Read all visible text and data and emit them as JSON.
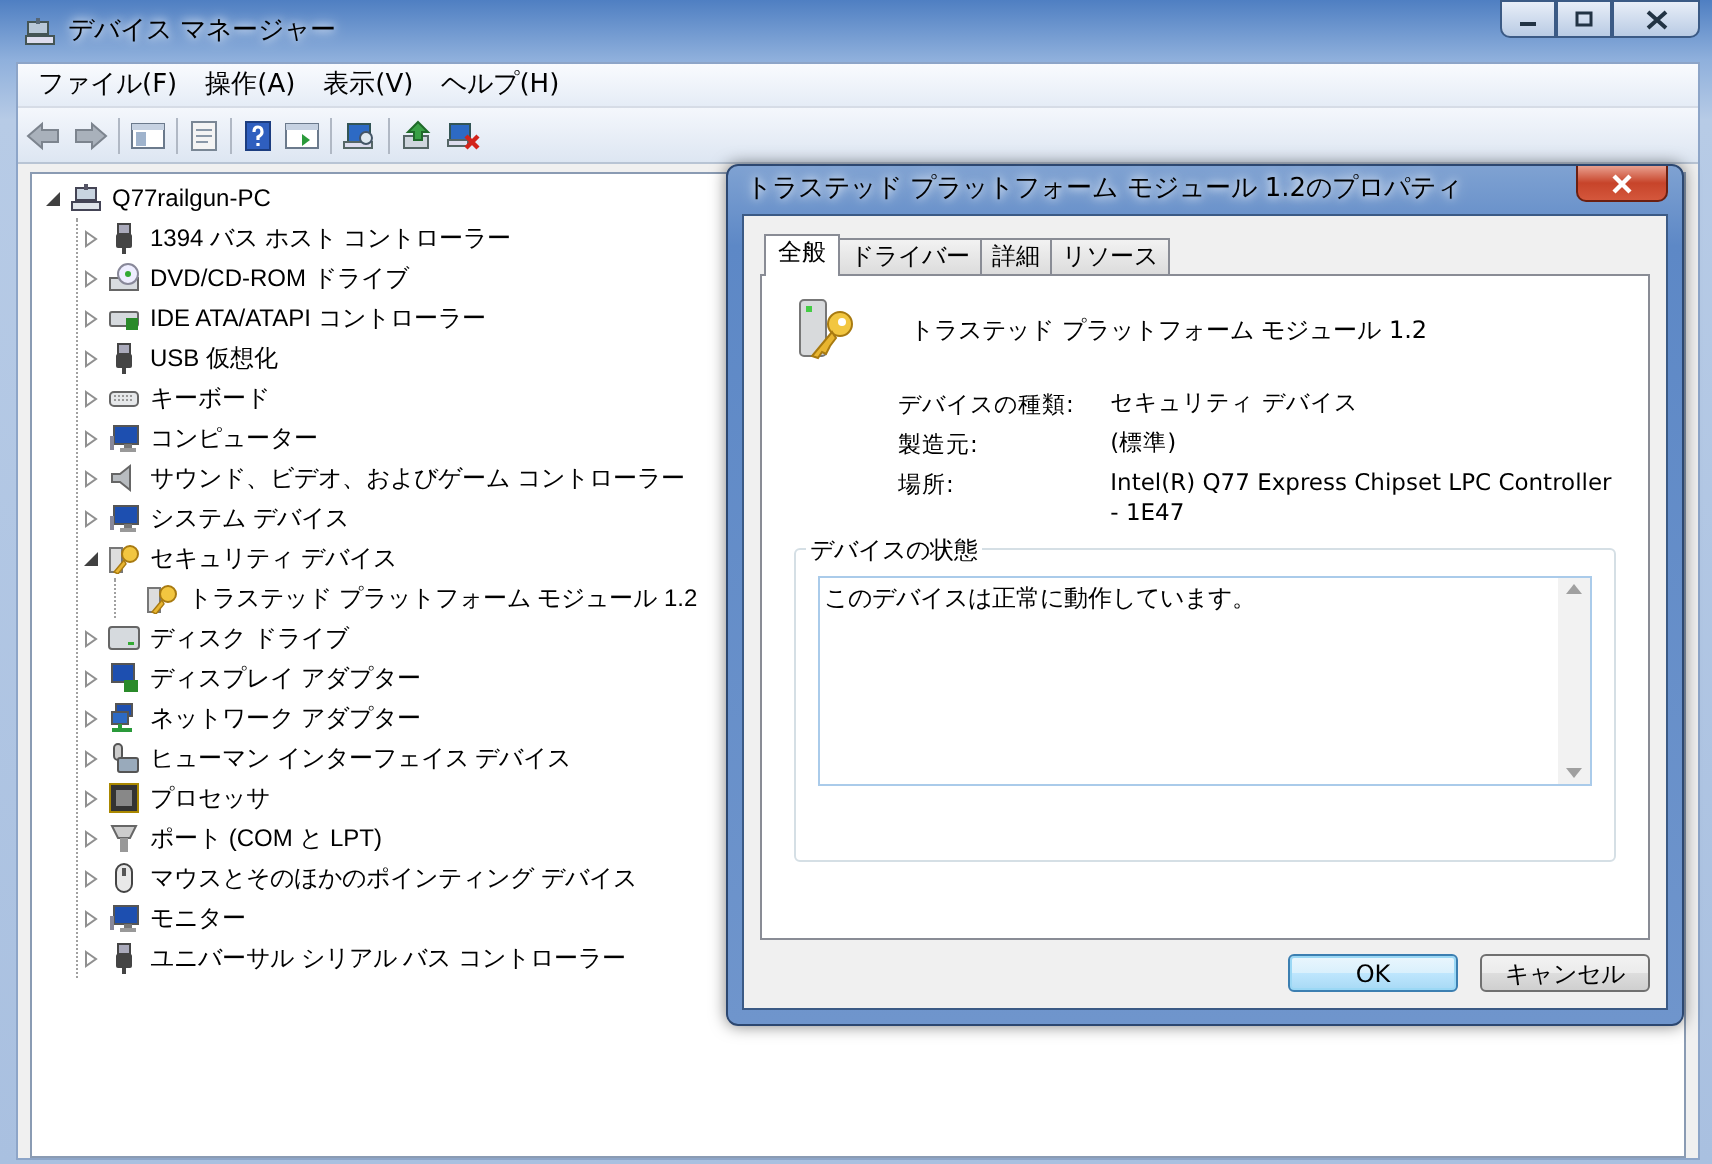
{
  "window": {
    "title": "デバイス マネージャー"
  },
  "menu": [
    "ファイル(F)",
    "操作(A)",
    "表示(V)",
    "ヘルプ(H)"
  ],
  "tree": {
    "label": "Q77railgun-PC",
    "kind": "computer",
    "expanded": true,
    "children": [
      {
        "label": "1394 バス ホスト コントローラー",
        "kind": "plug",
        "expanded": false
      },
      {
        "label": "DVD/CD-ROM ドライブ",
        "kind": "disc",
        "expanded": false
      },
      {
        "label": "IDE ATA/ATAPI コントローラー",
        "kind": "card",
        "expanded": false
      },
      {
        "label": "USB 仮想化",
        "kind": "plug",
        "expanded": false
      },
      {
        "label": "キーボード",
        "kind": "keyboard",
        "expanded": false
      },
      {
        "label": "コンピューター",
        "kind": "monitor",
        "expanded": false
      },
      {
        "label": "サウンド、ビデオ、およびゲーム コントローラー",
        "kind": "speaker",
        "expanded": false
      },
      {
        "label": "システム デバイス",
        "kind": "monitor",
        "expanded": false
      },
      {
        "label": "セキュリティ デバイス",
        "kind": "key",
        "expanded": true,
        "children": [
          {
            "label": "トラステッド プラットフォーム モジュール 1.2",
            "kind": "key"
          }
        ]
      },
      {
        "label": "ディスク ドライブ",
        "kind": "drive",
        "expanded": false
      },
      {
        "label": "ディスプレイ アダプター",
        "kind": "display",
        "expanded": false
      },
      {
        "label": "ネットワーク アダプター",
        "kind": "network",
        "expanded": false
      },
      {
        "label": "ヒューマン インターフェイス デバイス",
        "kind": "hid",
        "expanded": false
      },
      {
        "label": "プロセッサ",
        "kind": "chip",
        "expanded": false
      },
      {
        "label": "ポート (COM と LPT)",
        "kind": "port",
        "expanded": false
      },
      {
        "label": "マウスとそのほかのポインティング デバイス",
        "kind": "mouse",
        "expanded": false
      },
      {
        "label": "モニター",
        "kind": "monitor",
        "expanded": false
      },
      {
        "label": "ユニバーサル シリアル バス コントローラー",
        "kind": "plug",
        "expanded": false
      }
    ]
  },
  "dialog": {
    "title": "トラステッド プラットフォーム モジュール 1.2のプロパティ",
    "tabs": [
      {
        "label": "全般",
        "selected": true
      },
      {
        "label": "ドライバー",
        "selected": false
      },
      {
        "label": "詳細",
        "selected": false
      },
      {
        "label": "リソース",
        "selected": false
      }
    ],
    "device_name": "トラステッド プラットフォーム モジュール 1.2",
    "properties": [
      {
        "label": "デバイスの種類:",
        "value": "セキュリティ デバイス"
      },
      {
        "label": "製造元:",
        "value": "(標準)"
      },
      {
        "label": "場所:",
        "value": "Intel(R) Q77 Express Chipset LPC Controller - 1E47"
      }
    ],
    "status_group": "デバイスの状態",
    "status_text": "このデバイスは正常に動作しています。",
    "buttons": [
      {
        "label": "OK",
        "default": true
      },
      {
        "label": "キャンセル",
        "default": false
      }
    ]
  }
}
